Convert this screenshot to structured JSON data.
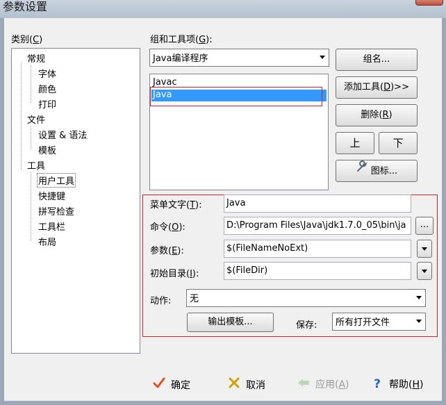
{
  "window": {
    "title": "参数设置"
  },
  "category": {
    "label": "类别(",
    "accel": "C",
    "label_end": ")",
    "tree": [
      {
        "label": "常规",
        "level": 0
      },
      {
        "label": "字体",
        "level": 1
      },
      {
        "label": "颜色",
        "level": 1
      },
      {
        "label": "打印",
        "level": 1
      },
      {
        "label": "文件",
        "level": 0
      },
      {
        "label": "设置 & 语法",
        "level": 1
      },
      {
        "label": "模板",
        "level": 1
      },
      {
        "label": "工具",
        "level": 0
      },
      {
        "label": "用户工具",
        "level": 1,
        "selected": true
      },
      {
        "label": "快捷键",
        "level": 1
      },
      {
        "label": "拼写检查",
        "level": 1
      },
      {
        "label": "工具栏",
        "level": 1
      },
      {
        "label": "布局",
        "level": 1
      }
    ]
  },
  "group": {
    "label": "组和工具项(",
    "accel": "G",
    "label_end": "):",
    "combo_value": "Java编译程序",
    "list": [
      {
        "label": "Javac",
        "selected": false
      },
      {
        "label": "Java",
        "selected": true
      }
    ]
  },
  "buttons": {
    "group_name": "组名...",
    "add_tool": "添加工具(",
    "add_tool_accel": "D",
    "add_tool_end": ")>>",
    "delete": "删除(",
    "delete_accel": "R",
    "delete_end": ")",
    "up": "上",
    "down": "下",
    "icon": "图标..."
  },
  "form": {
    "menu_text_label": "菜单文字(",
    "menu_text_accel": "T",
    "menu_text_end": "):",
    "menu_text_value": "Java",
    "command_label": "命令(",
    "command_accel": "O",
    "command_end": "):",
    "command_value": "D:\\Program Files\\Java\\jdk1.7.0_05\\bin\\ja",
    "browse": "...",
    "args_label": "参数(",
    "args_accel": "E",
    "args_end": "):",
    "args_value": "$(FileNameNoExt)",
    "initdir_label": "初始目录(",
    "initdir_accel": "I",
    "initdir_end": "):",
    "initdir_value": "$(FileDir)",
    "action_label": "动作:",
    "action_value": "无",
    "output_template": "输出模板...",
    "save_label": "保存:",
    "save_value": "所有打开文件"
  },
  "footer": {
    "ok": "确定",
    "cancel": "取消",
    "apply": "应用(",
    "apply_accel": "A",
    "apply_end": ")",
    "help": "帮助(",
    "help_accel": "H",
    "help_end": ")"
  },
  "colors": {
    "selection": "#3399ff",
    "highlight_box": "#d0202a",
    "ok_check": "#e05020",
    "cancel_x": "#d4a000",
    "help_q": "#2060c0"
  },
  "icons": {
    "ok": "checkmark-icon",
    "cancel": "x-icon",
    "apply": "arrow-left-icon",
    "help": "question-icon",
    "tool": "wrench-icon"
  }
}
